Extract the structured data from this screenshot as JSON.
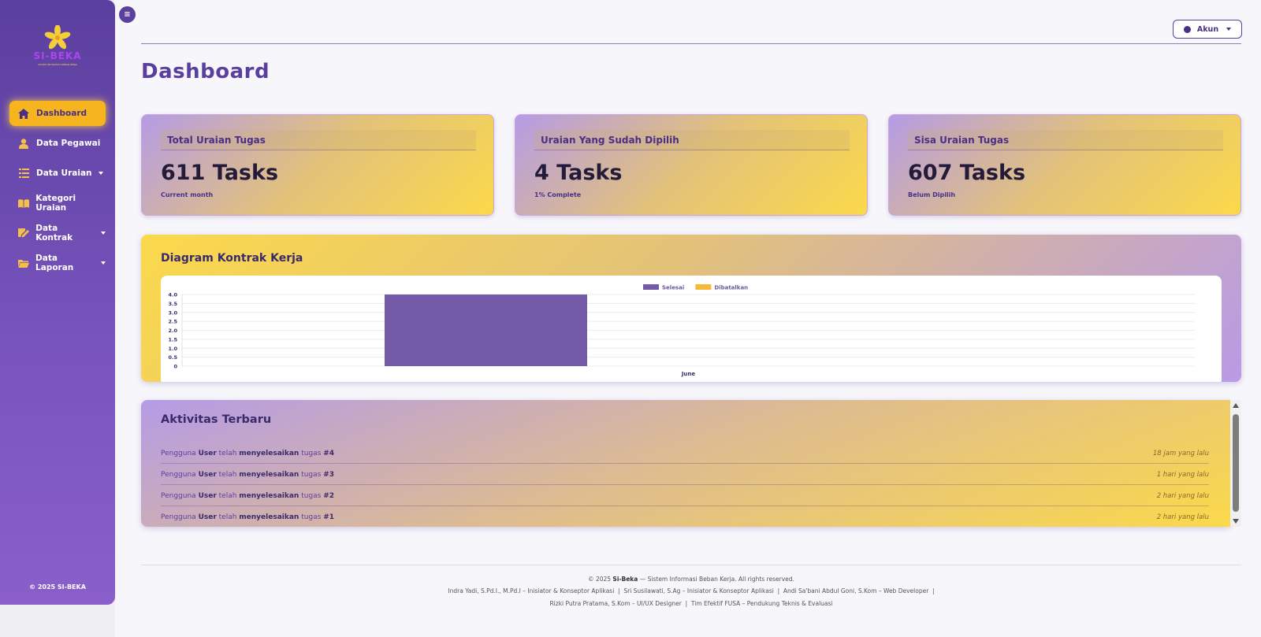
{
  "sidebar": {
    "logo_text": "SI-BEKA",
    "logo_subtitle": "SISTEM INFORMASI BEBAN KERJA",
    "items": [
      {
        "label": "Dashboard",
        "icon": "home-icon"
      },
      {
        "label": "Data Pegawai",
        "icon": "user-icon"
      },
      {
        "label": "Data Uraian",
        "icon": "list-icon"
      },
      {
        "label": "Kategori Uraian",
        "icon": "book-icon"
      },
      {
        "label": "Data Kontrak",
        "icon": "contract-icon"
      },
      {
        "label": "Data Laporan",
        "icon": "folder-icon"
      }
    ],
    "footer": "© 2025 SI-BEKA"
  },
  "header": {
    "toggle_icon": "≡",
    "account_label": "Akun"
  },
  "page": {
    "title": "Dashboard"
  },
  "stats": [
    {
      "header": "Total Uraian Tugas",
      "value": "611 Tasks",
      "sub": "Current month"
    },
    {
      "header": "Uraian Yang Sudah Dipilih",
      "value": "4 Tasks",
      "sub": "1% Complete"
    },
    {
      "header": "Sisa Uraian Tugas",
      "value": "607 Tasks",
      "sub": "Belum Dipilih"
    }
  ],
  "chart_card": {
    "title": "Diagram Kontrak Kerja"
  },
  "chart_data": {
    "type": "bar",
    "categories": [
      "June"
    ],
    "series": [
      {
        "name": "Selesai",
        "values": [
          4
        ],
        "color": "#735ba8"
      },
      {
        "name": "Dibatalkan",
        "values": [
          0
        ],
        "color": "#f6b93b"
      }
    ],
    "yticks": [
      "0",
      "0.5",
      "1.0",
      "1.5",
      "2.0",
      "2.5",
      "3.0",
      "3.5",
      "4.0"
    ],
    "ylim": [
      0,
      4
    ],
    "legend": "top-center",
    "grid": true
  },
  "activity": {
    "title": "Aktivitas Terbaru",
    "rows": [
      {
        "p1": "Pengguna ",
        "user": "User",
        "p2": " telah ",
        "action": "menyelesaikan",
        "p3": " tugas ",
        "task": "#4",
        "time": "18 jam yang lalu"
      },
      {
        "p1": "Pengguna ",
        "user": "User",
        "p2": " telah ",
        "action": "menyelesaikan",
        "p3": " tugas ",
        "task": "#3",
        "time": "1 hari yang lalu"
      },
      {
        "p1": "Pengguna ",
        "user": "User",
        "p2": " telah ",
        "action": "menyelesaikan",
        "p3": " tugas ",
        "task": "#2",
        "time": "2 hari yang lalu"
      },
      {
        "p1": "Pengguna ",
        "user": "User",
        "p2": " telah ",
        "action": "menyelesaikan",
        "p3": " tugas ",
        "task": "#1",
        "time": "2 hari yang lalu"
      }
    ]
  },
  "footer": {
    "line1_pre": "© 2025 ",
    "line1_brand": "Si-Beka",
    "line1_post": " — Sistem Informasi Beban Kerja. All rights reserved.",
    "line2": "Indra Yadi, S.Pd.I., M.Pd.I – Inisiator & Konseptor Aplikasi  |  Sri Susilawati, S.Ag – Inisiator & Konseptor Aplikasi  |  Andi Sa'bani Abdul Goni, S.Kom – Web Developer  |",
    "line3": "Rizki Putra Pratama, S.Kom – UI/UX Designer  |  Tim Efektif FUSA – Pendukung Teknis & Evaluasi"
  },
  "colors": {
    "primary": "#5b3f9e",
    "accent": "#f6b51e",
    "bar": "#735ba8"
  }
}
